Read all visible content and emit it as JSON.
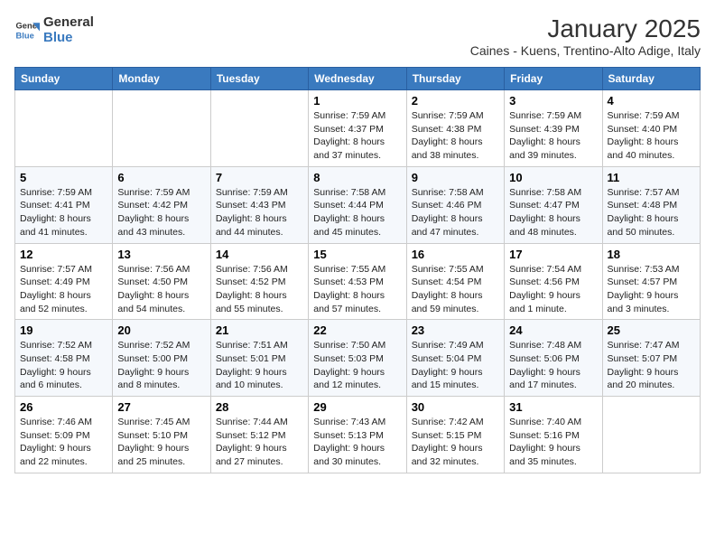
{
  "logo": {
    "line1": "General",
    "line2": "Blue"
  },
  "title": "January 2025",
  "subtitle": "Caines - Kuens, Trentino-Alto Adige, Italy",
  "weekdays": [
    "Sunday",
    "Monday",
    "Tuesday",
    "Wednesday",
    "Thursday",
    "Friday",
    "Saturday"
  ],
  "weeks": [
    [
      {
        "day": "",
        "content": ""
      },
      {
        "day": "",
        "content": ""
      },
      {
        "day": "",
        "content": ""
      },
      {
        "day": "1",
        "content": "Sunrise: 7:59 AM\nSunset: 4:37 PM\nDaylight: 8 hours and 37 minutes."
      },
      {
        "day": "2",
        "content": "Sunrise: 7:59 AM\nSunset: 4:38 PM\nDaylight: 8 hours and 38 minutes."
      },
      {
        "day": "3",
        "content": "Sunrise: 7:59 AM\nSunset: 4:39 PM\nDaylight: 8 hours and 39 minutes."
      },
      {
        "day": "4",
        "content": "Sunrise: 7:59 AM\nSunset: 4:40 PM\nDaylight: 8 hours and 40 minutes."
      }
    ],
    [
      {
        "day": "5",
        "content": "Sunrise: 7:59 AM\nSunset: 4:41 PM\nDaylight: 8 hours and 41 minutes."
      },
      {
        "day": "6",
        "content": "Sunrise: 7:59 AM\nSunset: 4:42 PM\nDaylight: 8 hours and 43 minutes."
      },
      {
        "day": "7",
        "content": "Sunrise: 7:59 AM\nSunset: 4:43 PM\nDaylight: 8 hours and 44 minutes."
      },
      {
        "day": "8",
        "content": "Sunrise: 7:58 AM\nSunset: 4:44 PM\nDaylight: 8 hours and 45 minutes."
      },
      {
        "day": "9",
        "content": "Sunrise: 7:58 AM\nSunset: 4:46 PM\nDaylight: 8 hours and 47 minutes."
      },
      {
        "day": "10",
        "content": "Sunrise: 7:58 AM\nSunset: 4:47 PM\nDaylight: 8 hours and 48 minutes."
      },
      {
        "day": "11",
        "content": "Sunrise: 7:57 AM\nSunset: 4:48 PM\nDaylight: 8 hours and 50 minutes."
      }
    ],
    [
      {
        "day": "12",
        "content": "Sunrise: 7:57 AM\nSunset: 4:49 PM\nDaylight: 8 hours and 52 minutes."
      },
      {
        "day": "13",
        "content": "Sunrise: 7:56 AM\nSunset: 4:50 PM\nDaylight: 8 hours and 54 minutes."
      },
      {
        "day": "14",
        "content": "Sunrise: 7:56 AM\nSunset: 4:52 PM\nDaylight: 8 hours and 55 minutes."
      },
      {
        "day": "15",
        "content": "Sunrise: 7:55 AM\nSunset: 4:53 PM\nDaylight: 8 hours and 57 minutes."
      },
      {
        "day": "16",
        "content": "Sunrise: 7:55 AM\nSunset: 4:54 PM\nDaylight: 8 hours and 59 minutes."
      },
      {
        "day": "17",
        "content": "Sunrise: 7:54 AM\nSunset: 4:56 PM\nDaylight: 9 hours and 1 minute."
      },
      {
        "day": "18",
        "content": "Sunrise: 7:53 AM\nSunset: 4:57 PM\nDaylight: 9 hours and 3 minutes."
      }
    ],
    [
      {
        "day": "19",
        "content": "Sunrise: 7:52 AM\nSunset: 4:58 PM\nDaylight: 9 hours and 6 minutes."
      },
      {
        "day": "20",
        "content": "Sunrise: 7:52 AM\nSunset: 5:00 PM\nDaylight: 9 hours and 8 minutes."
      },
      {
        "day": "21",
        "content": "Sunrise: 7:51 AM\nSunset: 5:01 PM\nDaylight: 9 hours and 10 minutes."
      },
      {
        "day": "22",
        "content": "Sunrise: 7:50 AM\nSunset: 5:03 PM\nDaylight: 9 hours and 12 minutes."
      },
      {
        "day": "23",
        "content": "Sunrise: 7:49 AM\nSunset: 5:04 PM\nDaylight: 9 hours and 15 minutes."
      },
      {
        "day": "24",
        "content": "Sunrise: 7:48 AM\nSunset: 5:06 PM\nDaylight: 9 hours and 17 minutes."
      },
      {
        "day": "25",
        "content": "Sunrise: 7:47 AM\nSunset: 5:07 PM\nDaylight: 9 hours and 20 minutes."
      }
    ],
    [
      {
        "day": "26",
        "content": "Sunrise: 7:46 AM\nSunset: 5:09 PM\nDaylight: 9 hours and 22 minutes."
      },
      {
        "day": "27",
        "content": "Sunrise: 7:45 AM\nSunset: 5:10 PM\nDaylight: 9 hours and 25 minutes."
      },
      {
        "day": "28",
        "content": "Sunrise: 7:44 AM\nSunset: 5:12 PM\nDaylight: 9 hours and 27 minutes."
      },
      {
        "day": "29",
        "content": "Sunrise: 7:43 AM\nSunset: 5:13 PM\nDaylight: 9 hours and 30 minutes."
      },
      {
        "day": "30",
        "content": "Sunrise: 7:42 AM\nSunset: 5:15 PM\nDaylight: 9 hours and 32 minutes."
      },
      {
        "day": "31",
        "content": "Sunrise: 7:40 AM\nSunset: 5:16 PM\nDaylight: 9 hours and 35 minutes."
      },
      {
        "day": "",
        "content": ""
      }
    ]
  ]
}
